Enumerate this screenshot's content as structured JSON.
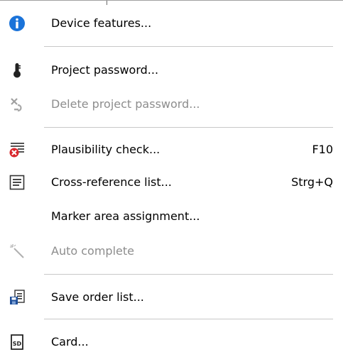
{
  "menu": {
    "items": [
      {
        "label": "Device features...",
        "icon": "info-icon",
        "enabled": true
      },
      {
        "label": "Project password...",
        "icon": "thermometer-icon",
        "enabled": true
      },
      {
        "label": "Delete project password...",
        "icon": "delete-password-icon",
        "enabled": false
      },
      {
        "label": "Plausibility check...",
        "shortcut": "F10",
        "icon": "plausibility-check-icon",
        "enabled": true
      },
      {
        "label": "Cross-reference list...",
        "shortcut": "Strg+Q",
        "icon": "list-icon",
        "enabled": true
      },
      {
        "label": "Marker area assignment...",
        "icon": "",
        "enabled": true
      },
      {
        "label": "Auto complete",
        "icon": "magic-wand-icon",
        "enabled": false
      },
      {
        "label": "Save order list...",
        "icon": "save-order-list-icon",
        "enabled": true
      },
      {
        "label": "Card...",
        "icon": "sd-card-icon",
        "enabled": true
      }
    ],
    "sd_card_text": "SD"
  },
  "colors": {
    "info_blue": "#1a73d9",
    "error_red": "#d9262b",
    "save_blue": "#1f4f9a",
    "disabled_text": "#8d8d8d",
    "separator": "#c8c8c8"
  }
}
